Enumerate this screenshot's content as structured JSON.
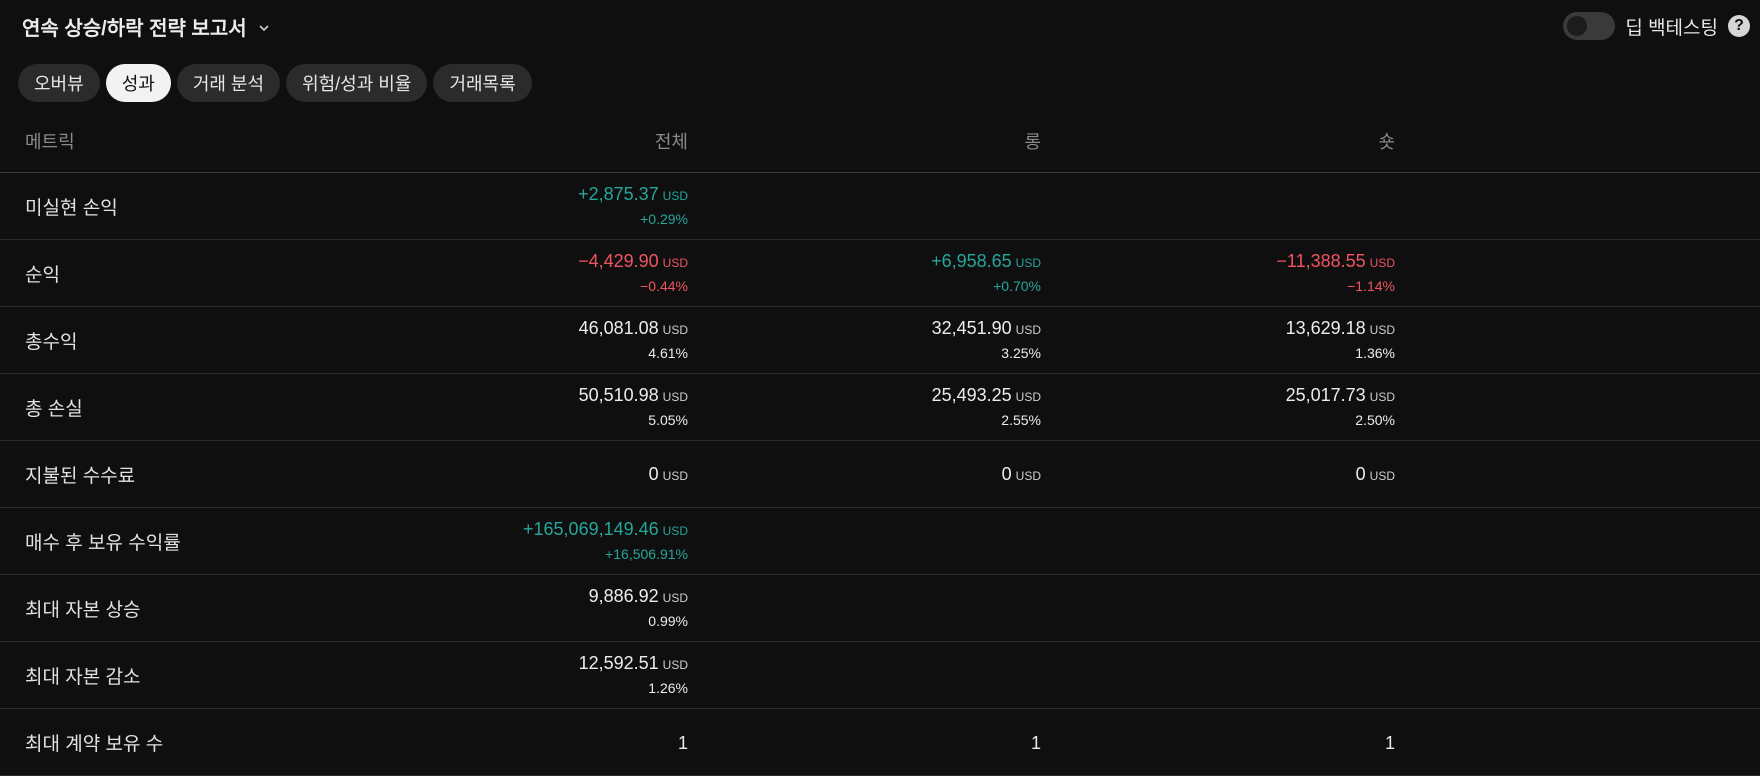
{
  "header": {
    "title": "연속 상승/하락 전략 보고서",
    "deep_backtesting_label": "딥 백테스팅",
    "help_label": "?"
  },
  "tabs": [
    {
      "label": "오버뷰",
      "active": false
    },
    {
      "label": "성과",
      "active": true
    },
    {
      "label": "거래 분석",
      "active": false
    },
    {
      "label": "위험/성과 비율",
      "active": false
    },
    {
      "label": "거래목록",
      "active": false
    }
  ],
  "table": {
    "columns": {
      "metric": "메트릭",
      "all": "전체",
      "long": "롱",
      "short": "숏"
    },
    "currency": "USD",
    "rows": [
      {
        "label": "미실현 손익",
        "all": {
          "value": "+2,875.37",
          "pct": "+0.29%",
          "tone": "pos"
        },
        "long": null,
        "short": null
      },
      {
        "label": "순익",
        "all": {
          "value": "−4,429.90",
          "pct": "−0.44%",
          "tone": "neg"
        },
        "long": {
          "value": "+6,958.65",
          "pct": "+0.70%",
          "tone": "pos"
        },
        "short": {
          "value": "−11,388.55",
          "pct": "−1.14%",
          "tone": "neg"
        }
      },
      {
        "label": "총수익",
        "all": {
          "value": "46,081.08",
          "pct": "4.61%",
          "tone": "neu"
        },
        "long": {
          "value": "32,451.90",
          "pct": "3.25%",
          "tone": "neu"
        },
        "short": {
          "value": "13,629.18",
          "pct": "1.36%",
          "tone": "neu"
        }
      },
      {
        "label": "총 손실",
        "all": {
          "value": "50,510.98",
          "pct": "5.05%",
          "tone": "neu"
        },
        "long": {
          "value": "25,493.25",
          "pct": "2.55%",
          "tone": "neu"
        },
        "short": {
          "value": "25,017.73",
          "pct": "2.50%",
          "tone": "neu"
        }
      },
      {
        "label": "지불된 수수료",
        "all": {
          "value": "0",
          "pct": null,
          "tone": "neu"
        },
        "long": {
          "value": "0",
          "pct": null,
          "tone": "neu"
        },
        "short": {
          "value": "0",
          "pct": null,
          "tone": "neu"
        }
      },
      {
        "label": "매수 후 보유 수익률",
        "all": {
          "value": "+165,069,149.46",
          "pct": "+16,506.91%",
          "tone": "pos"
        },
        "long": null,
        "short": null
      },
      {
        "label": "최대 자본 상승",
        "all": {
          "value": "9,886.92",
          "pct": "0.99%",
          "tone": "neu"
        },
        "long": null,
        "short": null
      },
      {
        "label": "최대 자본 감소",
        "all": {
          "value": "12,592.51",
          "pct": "1.26%",
          "tone": "neu"
        },
        "long": null,
        "short": null
      },
      {
        "label": "최대 계약 보유 수",
        "all": {
          "value": "1",
          "pct": null,
          "tone": "neu",
          "no_unit": true
        },
        "long": {
          "value": "1",
          "pct": null,
          "tone": "neu",
          "no_unit": true
        },
        "short": {
          "value": "1",
          "pct": null,
          "tone": "neu",
          "no_unit": true
        }
      }
    ]
  },
  "colors": {
    "positive": "#26a69a",
    "negative": "#f05561",
    "background": "#0f0f0f"
  }
}
